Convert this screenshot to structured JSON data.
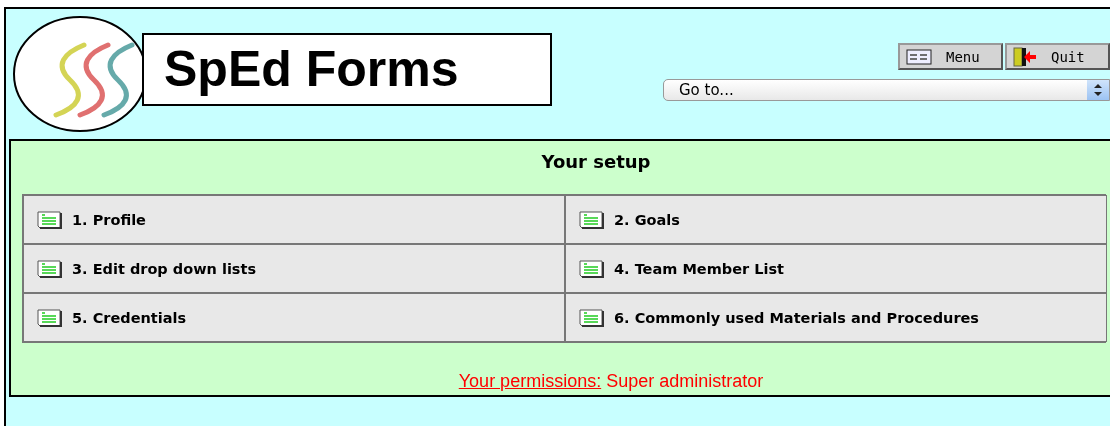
{
  "header": {
    "title": "SpEd Forms",
    "buttons": [
      {
        "kind": "menu",
        "label": "Menu"
      },
      {
        "kind": "quit",
        "label": "Quit"
      }
    ],
    "goto": {
      "value": "Go to..."
    }
  },
  "setup": {
    "heading": "Your setup",
    "items": [
      {
        "label": "1. Profile"
      },
      {
        "label": "2. Goals"
      },
      {
        "label": "3. Edit drop down lists"
      },
      {
        "label": "4. Team Member List"
      },
      {
        "label": "5. Credentials"
      },
      {
        "label": "6. Commonly used Materials and Procedures"
      }
    ],
    "permissions": {
      "link": "Your permissions:",
      "value": "Super administrator"
    }
  }
}
